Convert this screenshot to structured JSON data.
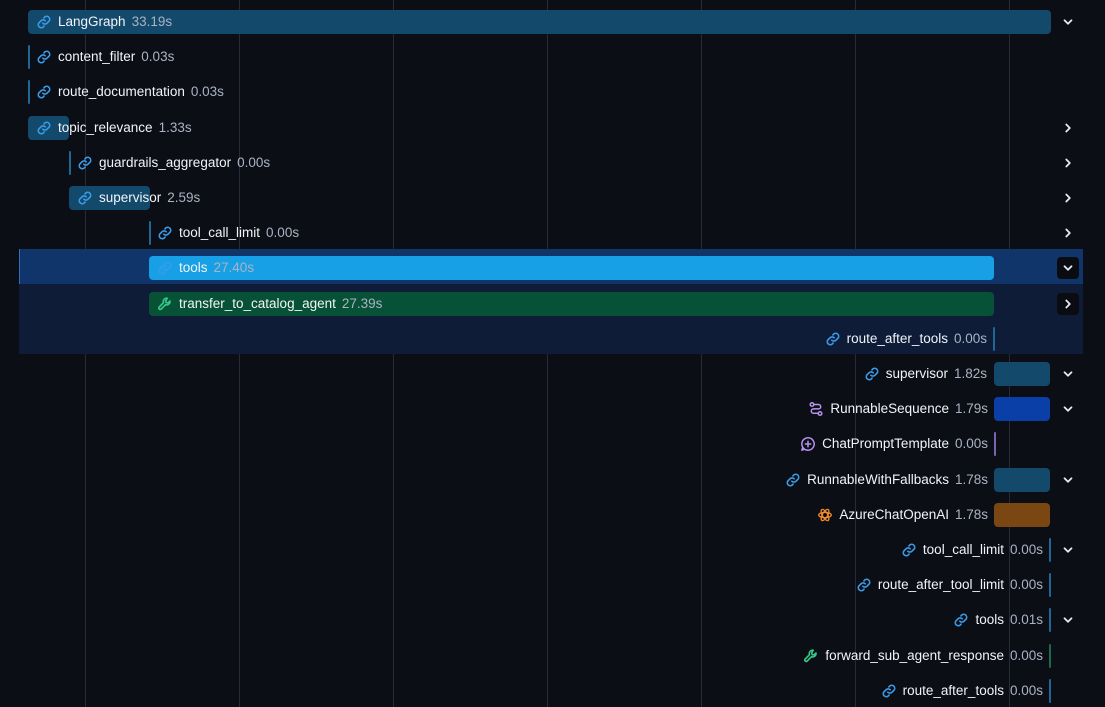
{
  "colors": {
    "background": "#0c0e15",
    "chain_bar": "#13496b",
    "chain_bar_selected": "#18a0e6",
    "tool_bar": "#075236",
    "sequence_bar": "#0b3fa8",
    "llm_bar": "#7a4611",
    "selected_row": "#10356a",
    "selected_group": "#0e1c38",
    "link_icon": "#3a9be8",
    "tool_icon": "#34c98a",
    "prompt_icon": "#b693f0",
    "llm_icon": "#f08a2a"
  },
  "rows": [
    {
      "name": "LangGraph",
      "duration": "33.19s",
      "icon": "link-icon",
      "chevron": "down"
    },
    {
      "name": "content_filter",
      "duration": "0.03s",
      "icon": "link-icon",
      "chevron": ""
    },
    {
      "name": "route_documentation",
      "duration": "0.03s",
      "icon": "link-icon",
      "chevron": ""
    },
    {
      "name": "topic_relevance",
      "duration": "1.33s",
      "icon": "link-icon",
      "chevron": "right"
    },
    {
      "name": "guardrails_aggregator",
      "duration": "0.00s",
      "icon": "link-icon",
      "chevron": "right"
    },
    {
      "name": "supervisor",
      "duration": "2.59s",
      "icon": "link-icon",
      "chevron": "right"
    },
    {
      "name": "tool_call_limit",
      "duration": "0.00s",
      "icon": "link-icon",
      "chevron": "right"
    },
    {
      "name": "tools",
      "duration": "27.40s",
      "icon": "link-icon",
      "chevron": "down",
      "selected": true
    },
    {
      "name": "transfer_to_catalog_agent",
      "duration": "27.39s",
      "icon": "wrench-icon",
      "chevron": "right"
    },
    {
      "name": "route_after_tools",
      "duration": "0.00s",
      "icon": "link-icon",
      "chevron": ""
    },
    {
      "name": "supervisor",
      "duration": "1.82s",
      "icon": "link-icon",
      "chevron": "down"
    },
    {
      "name": "RunnableSequence",
      "duration": "1.79s",
      "icon": "sequence-icon",
      "chevron": "down"
    },
    {
      "name": "ChatPromptTemplate",
      "duration": "0.00s",
      "icon": "prompt-icon",
      "chevron": ""
    },
    {
      "name": "RunnableWithFallbacks",
      "duration": "1.78s",
      "icon": "link-icon",
      "chevron": "down"
    },
    {
      "name": "AzureChatOpenAI",
      "duration": "1.78s",
      "icon": "openai-icon",
      "chevron": ""
    },
    {
      "name": "tool_call_limit",
      "duration": "0.00s",
      "icon": "link-icon",
      "chevron": "down"
    },
    {
      "name": "route_after_tool_limit",
      "duration": "0.00s",
      "icon": "link-icon",
      "chevron": ""
    },
    {
      "name": "tools",
      "duration": "0.01s",
      "icon": "link-icon",
      "chevron": "down"
    },
    {
      "name": "forward_sub_agent_response",
      "duration": "0.00s",
      "icon": "wrench-icon",
      "chevron": ""
    },
    {
      "name": "route_after_tools",
      "duration": "0.00s",
      "icon": "link-icon",
      "chevron": ""
    }
  ]
}
